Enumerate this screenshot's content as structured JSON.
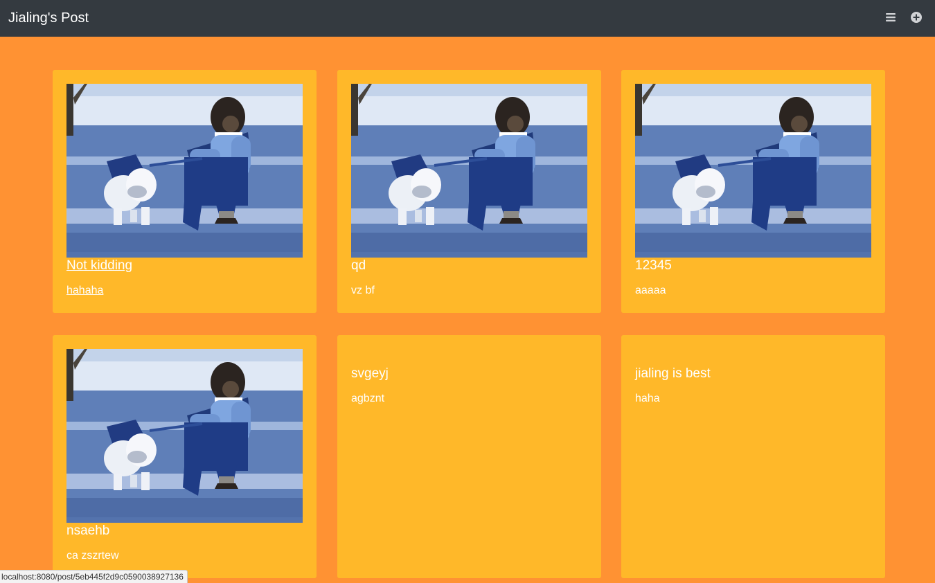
{
  "app": {
    "title": "Jialing's Post"
  },
  "navbar": {
    "menu_icon": "hamburger-menu-icon",
    "add_icon": "plus-circle-icon"
  },
  "posts": [
    {
      "title": "Not kidding",
      "text": "hahaha",
      "image": "chimp-walking-bulldog"
    },
    {
      "title": "qd",
      "text": "vz bf",
      "image": "chimp-walking-bulldog"
    },
    {
      "title": "12345",
      "text": "aaaaa",
      "image": "chimp-walking-bulldog"
    },
    {
      "title": "nsaehb",
      "text": "ca zszrtew",
      "image": "chimp-walking-bulldog"
    },
    {
      "title": "svgeyj",
      "text": "agbznt"
    },
    {
      "title": "jialing is best",
      "text": "haha"
    }
  ],
  "status_url": "localhost:8080/post/5eb445f2d9c0590038927136",
  "colors": {
    "page_bg": "#ff9233",
    "card_bg": "#ffb829",
    "navbar_bg": "#343a40"
  }
}
